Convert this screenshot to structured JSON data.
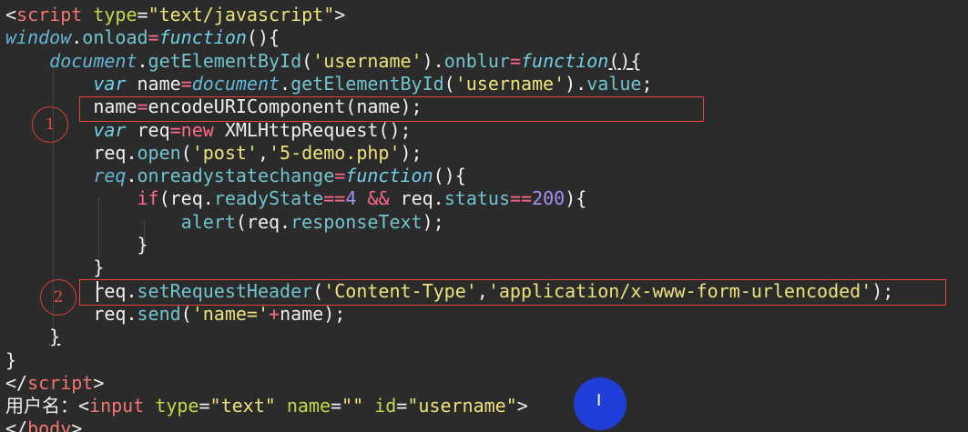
{
  "colors": {
    "background": "#2c2b2b",
    "plain": "#f0f0f0",
    "tag": "#f2766f",
    "attr": "#c2d84c",
    "string": "#ece27a",
    "keyword": "#6fd0e8",
    "property": "#71c3ce",
    "italic_identifier": "#63b7d6",
    "operator": "#ff6a8a",
    "number": "#a98ef3",
    "highlight_box": "#e8433a"
  },
  "code_lines": [
    [
      {
        "t": "<",
        "c": "plain"
      },
      {
        "t": "script",
        "c": "tag"
      },
      {
        "t": " "
      },
      {
        "t": "type",
        "c": "attr"
      },
      {
        "t": "="
      },
      {
        "t": "\"text/javascript\"",
        "c": "string"
      },
      {
        "t": ">"
      }
    ],
    [
      {
        "t": "window",
        "c": "italic_identifier",
        "i": 1
      },
      {
        "t": "."
      },
      {
        "t": "onload",
        "c": "property"
      },
      {
        "t": "=",
        "c": "operator"
      },
      {
        "t": "function",
        "c": "keyword",
        "i": 1
      },
      {
        "t": "(){"
      }
    ],
    [
      {
        "t": "    "
      },
      {
        "t": "document",
        "c": "italic_identifier",
        "i": 1
      },
      {
        "t": "."
      },
      {
        "t": "getElementById",
        "c": "property"
      },
      {
        "t": "("
      },
      {
        "t": "'username'",
        "c": "string"
      },
      {
        "t": ")."
      },
      {
        "t": "onblur",
        "c": "property"
      },
      {
        "t": "=",
        "c": "operator"
      },
      {
        "t": "function",
        "c": "keyword",
        "i": 1
      },
      {
        "t": "(){",
        "u": 1
      }
    ],
    [
      {
        "t": "        "
      },
      {
        "t": "var",
        "c": "keyword",
        "i": 1
      },
      {
        "t": " name"
      },
      {
        "t": "=",
        "c": "operator"
      },
      {
        "t": "document",
        "c": "italic_identifier",
        "i": 1
      },
      {
        "t": "."
      },
      {
        "t": "getElementById",
        "c": "property"
      },
      {
        "t": "("
      },
      {
        "t": "'username'",
        "c": "string"
      },
      {
        "t": ")."
      },
      {
        "t": "value",
        "c": "property"
      },
      {
        "t": ";"
      }
    ],
    [
      {
        "t": "        name"
      },
      {
        "t": "=",
        "c": "operator"
      },
      {
        "t": "encodeURIComponent(name);"
      }
    ],
    [
      {
        "t": "        "
      },
      {
        "t": "var",
        "c": "keyword",
        "i": 1
      },
      {
        "t": " req"
      },
      {
        "t": "=",
        "c": "operator"
      },
      {
        "t": "new",
        "c": "operator"
      },
      {
        "t": " XMLHttpRequest();"
      }
    ],
    [
      {
        "t": "        req."
      },
      {
        "t": "open",
        "c": "property"
      },
      {
        "t": "("
      },
      {
        "t": "'post'",
        "c": "string"
      },
      {
        "t": ","
      },
      {
        "t": "'5-demo.php'",
        "c": "string"
      },
      {
        "t": ");"
      }
    ],
    [
      {
        "t": "        "
      },
      {
        "t": "req",
        "c": "italic_identifier",
        "i": 1
      },
      {
        "t": "."
      },
      {
        "t": "onreadystatechange",
        "c": "property"
      },
      {
        "t": "=",
        "c": "operator"
      },
      {
        "t": "function",
        "c": "keyword",
        "i": 1
      },
      {
        "t": "(){"
      }
    ],
    [
      {
        "t": "            "
      },
      {
        "t": "if",
        "c": "operator"
      },
      {
        "t": "(req."
      },
      {
        "t": "readyState",
        "c": "property"
      },
      {
        "t": "==",
        "c": "operator"
      },
      {
        "t": "4",
        "c": "number"
      },
      {
        "t": " "
      },
      {
        "t": "&&",
        "c": "operator"
      },
      {
        "t": " req."
      },
      {
        "t": "status",
        "c": "property"
      },
      {
        "t": "==",
        "c": "operator"
      },
      {
        "t": "200",
        "c": "number"
      },
      {
        "t": "){"
      }
    ],
    [
      {
        "t": "                "
      },
      {
        "t": "alert",
        "c": "property"
      },
      {
        "t": "(req."
      },
      {
        "t": "responseText",
        "c": "property"
      },
      {
        "t": ");"
      }
    ],
    [
      {
        "t": "            }"
      }
    ],
    [
      {
        "t": "        }"
      }
    ],
    [
      {
        "t": "        req."
      },
      {
        "t": "setRequestHeader",
        "c": "property"
      },
      {
        "t": "("
      },
      {
        "t": "'Content-Type'",
        "c": "string"
      },
      {
        "t": ","
      },
      {
        "t": "'application/x-www-form-urlencoded'",
        "c": "string"
      },
      {
        "t": ");"
      }
    ],
    [
      {
        "t": "        req."
      },
      {
        "t": "send",
        "c": "property"
      },
      {
        "t": "("
      },
      {
        "t": "'name='",
        "c": "string"
      },
      {
        "t": "+",
        "c": "operator"
      },
      {
        "t": "name);"
      }
    ],
    [
      {
        "t": "    "
      },
      {
        "t": "}",
        "u": 1
      }
    ],
    [
      {
        "t": "}"
      }
    ],
    [
      {
        "t": "</"
      },
      {
        "t": "script",
        "c": "tag"
      },
      {
        "t": ">"
      }
    ],
    [
      {
        "t": "用户名："
      },
      {
        "t": "<"
      },
      {
        "t": "input",
        "c": "tag"
      },
      {
        "t": " "
      },
      {
        "t": "type",
        "c": "attr"
      },
      {
        "t": "="
      },
      {
        "t": "\"text\"",
        "c": "string"
      },
      {
        "t": " "
      },
      {
        "t": "name",
        "c": "attr"
      },
      {
        "t": "="
      },
      {
        "t": "\"\"",
        "c": "string"
      },
      {
        "t": " "
      },
      {
        "t": "id",
        "c": "attr"
      },
      {
        "t": "="
      },
      {
        "t": "\"username\"",
        "c": "string"
      },
      {
        "t": ">"
      }
    ],
    [
      {
        "t": "</"
      },
      {
        "t": "body",
        "c": "tag"
      },
      {
        "t": ">"
      }
    ]
  ],
  "annotations": {
    "marker_1": "1",
    "marker_2": "2"
  },
  "mouse_cursor_glyph": "I"
}
